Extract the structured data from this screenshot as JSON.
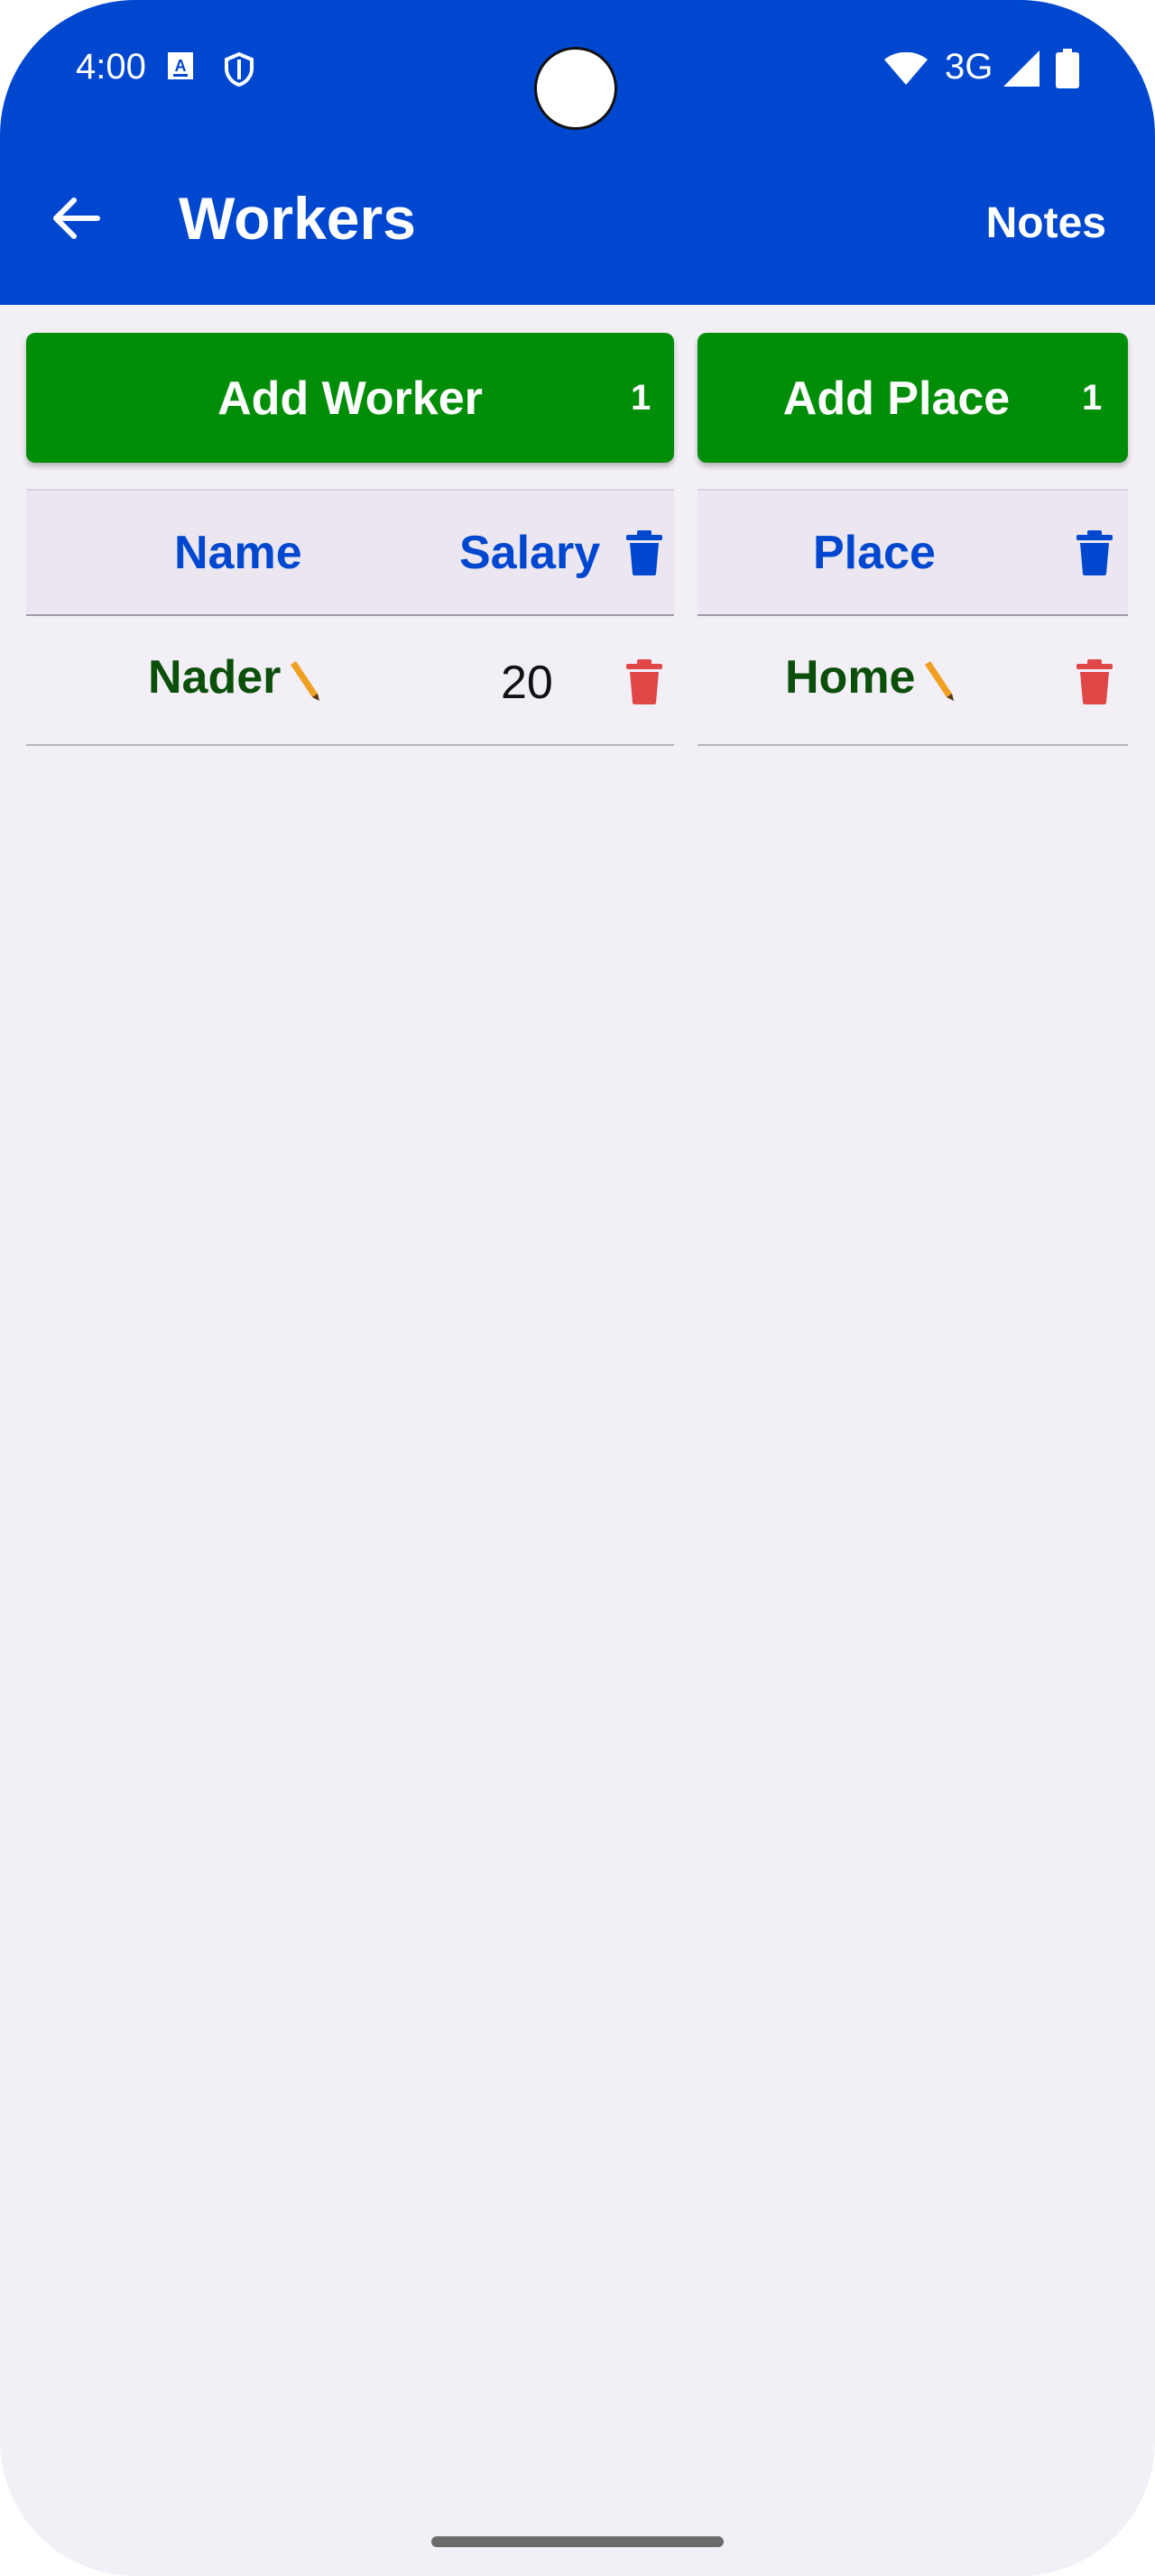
{
  "status_bar": {
    "time": "4:00",
    "network": "3G",
    "icons": [
      "a11y-icon",
      "shield-icon",
      "wifi-icon",
      "signal-icon",
      "battery-icon"
    ]
  },
  "app_bar": {
    "title": "Workers",
    "action": "Notes",
    "back_icon": "arrow-left-icon"
  },
  "workers_panel": {
    "add_label": "Add Worker",
    "count": "1",
    "headers": {
      "name": "Name",
      "salary": "Salary"
    },
    "rows": [
      {
        "name": "Nader",
        "salary": "20"
      }
    ]
  },
  "places_panel": {
    "add_label": "Add Place",
    "count": "1",
    "headers": {
      "place": "Place"
    },
    "rows": [
      {
        "place": "Home"
      }
    ]
  },
  "colors": {
    "primary": "#0047d0",
    "add_button": "#008e08",
    "name_text": "#0b4f0b",
    "delete_row": "#e04848",
    "edit_icon": "#f0a020"
  }
}
